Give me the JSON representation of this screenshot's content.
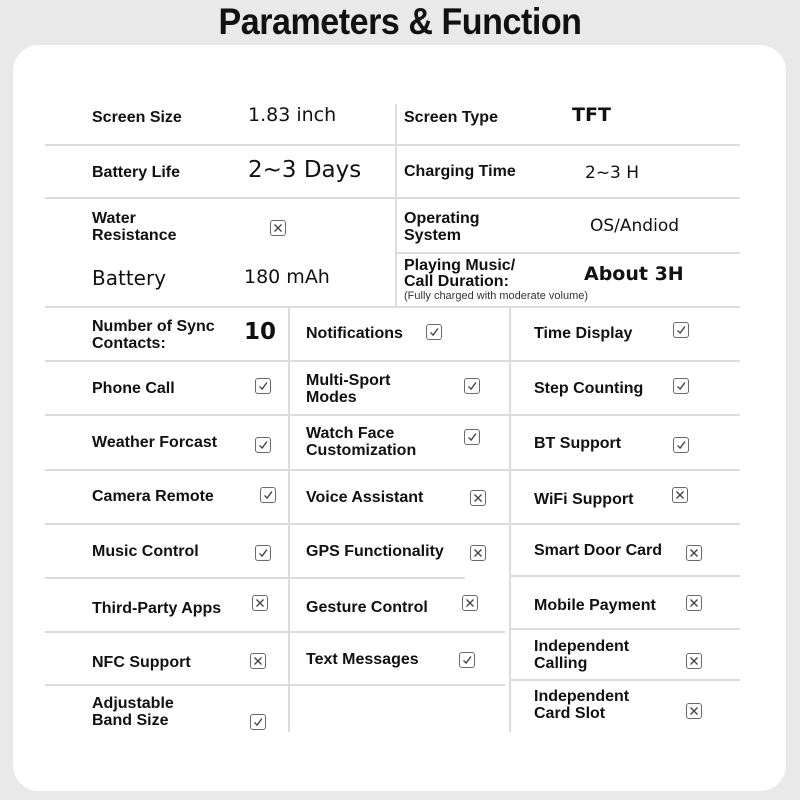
{
  "title": "Parameters & Function",
  "specs": {
    "screen_size": {
      "label": "Screen Size",
      "value": "1.83 inch"
    },
    "screen_type": {
      "label": "Screen Type",
      "value": "TFT"
    },
    "battery_life": {
      "label": "Battery Life",
      "value": "2~3 Days"
    },
    "charging_time": {
      "label": "Charging Time",
      "value": "2~3 H"
    },
    "water_resistance": {
      "label_line1": "Water",
      "label_line2": "Resistance",
      "value": "no"
    },
    "operating_system": {
      "label_line1": "Operating",
      "label_line2": "System",
      "value": "OS/Andiod"
    },
    "battery": {
      "label": "Battery",
      "value": "180 mAh"
    },
    "playing_music": {
      "label_line1": "Playing Music/",
      "label_line2": "Call Duration:",
      "note": "(Fully charged with moderate volume)",
      "value": "About 3H"
    }
  },
  "sync_contacts": {
    "label_line1": "Number of Sync",
    "label_line2": "Contacts:",
    "value": "10"
  },
  "features": {
    "notifications": {
      "label": "Notifications",
      "supported": true
    },
    "time_display": {
      "label": "Time Display",
      "supported": true
    },
    "phone_call": {
      "label": "Phone Call",
      "supported": true
    },
    "multi_sport": {
      "label_line1": "Multi-Sport",
      "label_line2": "Modes",
      "supported": true
    },
    "step_counting": {
      "label": "Step Counting",
      "supported": true
    },
    "weather": {
      "label": "Weather Forcast",
      "supported": true
    },
    "watch_face": {
      "label_line1": "Watch Face",
      "label_line2": "Customization",
      "supported": true
    },
    "bt_support": {
      "label": "BT Support",
      "supported": true
    },
    "camera_remote": {
      "label": "Camera Remote",
      "supported": true
    },
    "voice_assistant": {
      "label": "Voice Assistant",
      "supported": false
    },
    "wifi_support": {
      "label": "WiFi Support",
      "supported": false
    },
    "music_control": {
      "label": "Music Control",
      "supported": true
    },
    "gps": {
      "label": "GPS Functionality",
      "supported": false
    },
    "smart_door_card": {
      "label": "Smart Door Card",
      "supported": false
    },
    "third_party_apps": {
      "label": "Third-Party Apps",
      "supported": false
    },
    "gesture_control": {
      "label": "Gesture Control",
      "supported": false
    },
    "mobile_payment": {
      "label": "Mobile Payment",
      "supported": false
    },
    "nfc_support": {
      "label": "NFC Support",
      "supported": false
    },
    "text_messages": {
      "label": "Text Messages",
      "supported": true
    },
    "independent_calling": {
      "label_line1": "Independent",
      "label_line2": "Calling",
      "supported": false
    },
    "adjustable_band": {
      "label_line1": "Adjustable",
      "label_line2": "Band Size",
      "supported": true
    },
    "independent_card_slot": {
      "label_line1": "Independent",
      "label_line2": "Card Slot",
      "supported": false
    }
  },
  "colors": {
    "background": "#e9e9e9",
    "card": "#ffffff",
    "divider": "#dcdcdc",
    "checkbox_border": "#6a6a6a"
  }
}
